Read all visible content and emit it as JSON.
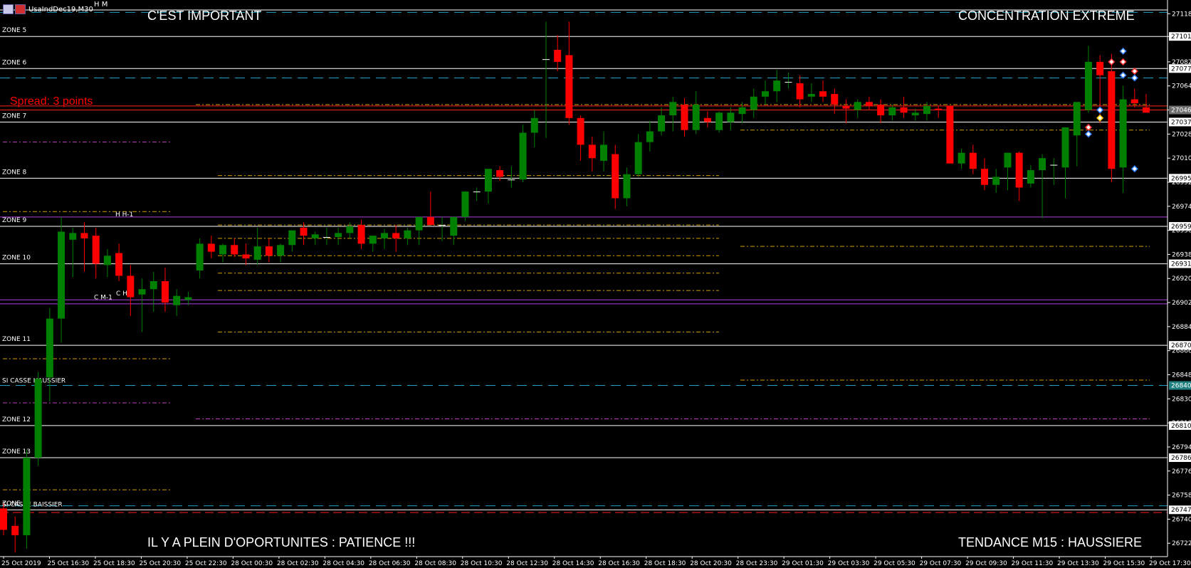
{
  "window": {
    "symbol": "UsaIndDec19,M30",
    "hm_label": "H M"
  },
  "banners": {
    "top_left": "C'EST IMPORTANT",
    "top_right": "CONCENTRATION EXTREME",
    "bottom_left": "IL Y A PLEIN D'OPORTUNITES : PATIENCE !!!",
    "bottom_right": "TENDANCE M15 : HAUSSIERE",
    "spread": "Spread: 3 points"
  },
  "colors": {
    "background": "#000000",
    "bull": "#008000",
    "bear": "#ff0000",
    "zone_line": "#ffffff",
    "cyan_dash": "#20a0c0",
    "orange_dash": "#d4a000",
    "magenta_dash": "#c040c0",
    "red_line": "#ff2020",
    "purple_line": "#b040e0"
  },
  "chart_data": {
    "type": "candlestick",
    "symbol": "UsaIndDec19",
    "timeframe": "M30",
    "ylim": [
      26712,
      27124
    ],
    "y_ticks": [
      27118,
      27101,
      27082,
      27064,
      27046,
      27028,
      27010,
      26992,
      26974,
      26956,
      26938,
      26920,
      26902,
      26884,
      26866,
      26848,
      26830,
      26812,
      26794,
      26776,
      26758,
      26740,
      26722
    ],
    "x_ticks": [
      "25 Oct 2019",
      "25 Oct 16:30",
      "25 Oct 18:30",
      "25 Oct 20:30",
      "25 Oct 22:30",
      "28 Oct 00:30",
      "28 Oct 02:30",
      "28 Oct 04:30",
      "28 Oct 06:30",
      "28 Oct 08:30",
      "28 Oct 10:30",
      "28 Oct 12:30",
      "28 Oct 14:30",
      "28 Oct 16:30",
      "28 Oct 18:30",
      "28 Oct 20:30",
      "28 Oct 23:30",
      "29 Oct 01:30",
      "29 Oct 03:30",
      "29 Oct 05:30",
      "29 Oct 07:30",
      "29 Oct 09:30",
      "29 Oct 11:30",
      "29 Oct 13:30",
      "29 Oct 15:30",
      "29 Oct 17:30"
    ],
    "price_labels": [
      {
        "value": 27101,
        "text": "27101",
        "style": "white"
      },
      {
        "value": 27077,
        "text": "27077",
        "style": "white"
      },
      {
        "value": 27046,
        "text": "27046",
        "style": "grey"
      },
      {
        "value": 27037,
        "text": "27037",
        "style": "white"
      },
      {
        "value": 26995,
        "text": "26995",
        "style": "white"
      },
      {
        "value": 26959,
        "text": "26959",
        "style": "white"
      },
      {
        "value": 26931,
        "text": "26931",
        "style": "white"
      },
      {
        "value": 26870,
        "text": "26870",
        "style": "white"
      },
      {
        "value": 26840,
        "text": "26840",
        "style": "cyan"
      },
      {
        "value": 26810,
        "text": "26810",
        "style": "white"
      },
      {
        "value": 26786,
        "text": "26786",
        "style": "white"
      },
      {
        "value": 26747,
        "text": "26747",
        "style": "white"
      }
    ],
    "zones": [
      {
        "label": "ZONE 5",
        "value": 27101
      },
      {
        "label": "ZONE 6",
        "value": 27077
      },
      {
        "label": "ZONE 7",
        "value": 27037
      },
      {
        "label": "ZONE 8",
        "value": 26995
      },
      {
        "label": "ZONE 9",
        "value": 26959
      },
      {
        "label": "ZONE 10",
        "value": 26931
      },
      {
        "label": "ZONE 11",
        "value": 26870
      },
      {
        "label": "ZONE 12",
        "value": 26810
      },
      {
        "label": "ZONE 13",
        "value": 26786
      },
      {
        "label": "ZONE 14",
        "value": 26747
      }
    ],
    "markers": [
      {
        "label": "SI CASSE HAUSSIER",
        "value": 26840
      },
      {
        "label": "SI CASSE BAISSIER",
        "value": 26748
      },
      {
        "label": "H H-1",
        "value": 26967
      },
      {
        "label": "C M-1",
        "value": 26905
      },
      {
        "label": "C H-1",
        "value": 26908
      }
    ],
    "candles": [
      {
        "o": 26748,
        "h": 26752,
        "l": 26728,
        "c": 26732
      },
      {
        "o": 26735,
        "h": 26742,
        "l": 26715,
        "c": 26728
      },
      {
        "o": 26728,
        "h": 26792,
        "l": 26718,
        "c": 26786
      },
      {
        "o": 26786,
        "h": 26850,
        "l": 26780,
        "c": 26845
      },
      {
        "o": 26846,
        "h": 26898,
        "l": 26828,
        "c": 26890
      },
      {
        "o": 26890,
        "h": 26966,
        "l": 26872,
        "c": 26955
      },
      {
        "o": 26949,
        "h": 26958,
        "l": 26921,
        "c": 26954
      },
      {
        "o": 26954,
        "h": 26962,
        "l": 26925,
        "c": 26950
      },
      {
        "o": 26952,
        "h": 26958,
        "l": 26920,
        "c": 26931
      },
      {
        "o": 26930,
        "h": 26942,
        "l": 26921,
        "c": 26937
      },
      {
        "o": 26939,
        "h": 26946,
        "l": 26918,
        "c": 26922
      },
      {
        "o": 26922,
        "h": 26930,
        "l": 26892,
        "c": 26906
      },
      {
        "o": 26908,
        "h": 26920,
        "l": 26880,
        "c": 26912
      },
      {
        "o": 26912,
        "h": 26925,
        "l": 26895,
        "c": 26918
      },
      {
        "o": 26918,
        "h": 26928,
        "l": 26895,
        "c": 26902
      },
      {
        "o": 26900,
        "h": 26912,
        "l": 26892,
        "c": 26907
      },
      {
        "o": 26904,
        "h": 26910,
        "l": 26900,
        "c": 26906
      },
      {
        "o": 26926,
        "h": 26950,
        "l": 26920,
        "c": 26946
      },
      {
        "o": 26946,
        "h": 26952,
        "l": 26935,
        "c": 26940
      },
      {
        "o": 26938,
        "h": 26946,
        "l": 26932,
        "c": 26945
      },
      {
        "o": 26945,
        "h": 26950,
        "l": 26936,
        "c": 26938
      },
      {
        "o": 26938,
        "h": 26946,
        "l": 26930,
        "c": 26935
      },
      {
        "o": 26934,
        "h": 26958,
        "l": 26930,
        "c": 26944
      },
      {
        "o": 26944,
        "h": 26950,
        "l": 26932,
        "c": 26937
      },
      {
        "o": 26937,
        "h": 26946,
        "l": 26932,
        "c": 26945
      },
      {
        "o": 26945,
        "h": 26952,
        "l": 26940,
        "c": 26956
      },
      {
        "o": 26958,
        "h": 26962,
        "l": 26945,
        "c": 26952
      },
      {
        "o": 26950,
        "h": 26955,
        "l": 26945,
        "c": 26953
      },
      {
        "o": 26951,
        "h": 26958,
        "l": 26945,
        "c": 26951
      },
      {
        "o": 26951,
        "h": 26958,
        "l": 26945,
        "c": 26954
      },
      {
        "o": 26954,
        "h": 26962,
        "l": 26950,
        "c": 26959
      },
      {
        "o": 26960,
        "h": 26964,
        "l": 26942,
        "c": 26946
      },
      {
        "o": 26946,
        "h": 26952,
        "l": 26940,
        "c": 26952
      },
      {
        "o": 26950,
        "h": 26957,
        "l": 26942,
        "c": 26954
      },
      {
        "o": 26954,
        "h": 26960,
        "l": 26940,
        "c": 26950
      },
      {
        "o": 26950,
        "h": 26958,
        "l": 26945,
        "c": 26956
      },
      {
        "o": 26956,
        "h": 26966,
        "l": 26945,
        "c": 26966
      },
      {
        "o": 26966,
        "h": 26985,
        "l": 26960,
        "c": 26960
      },
      {
        "o": 26960,
        "h": 26966,
        "l": 26948,
        "c": 26960
      },
      {
        "o": 26952,
        "h": 26966,
        "l": 26945,
        "c": 26966
      },
      {
        "o": 26966,
        "h": 26985,
        "l": 26963,
        "c": 26985
      },
      {
        "o": 26985,
        "h": 26988,
        "l": 26978,
        "c": 26985
      },
      {
        "o": 26985,
        "h": 27002,
        "l": 26976,
        "c": 27002
      },
      {
        "o": 27001,
        "h": 27004,
        "l": 26993,
        "c": 26996
      },
      {
        "o": 26994,
        "h": 27004,
        "l": 26988,
        "c": 26994
      },
      {
        "o": 26994,
        "h": 27035,
        "l": 26992,
        "c": 27029
      },
      {
        "o": 27029,
        "h": 27046,
        "l": 27018,
        "c": 27040
      },
      {
        "o": 27084,
        "h": 27112,
        "l": 27025,
        "c": 27084
      },
      {
        "o": 27091,
        "h": 27102,
        "l": 27075,
        "c": 27082
      },
      {
        "o": 27087,
        "h": 27112,
        "l": 27035,
        "c": 27040
      },
      {
        "o": 27040,
        "h": 27042,
        "l": 27008,
        "c": 27020
      },
      {
        "o": 27020,
        "h": 27026,
        "l": 27000,
        "c": 27010
      },
      {
        "o": 27008,
        "h": 27030,
        "l": 27000,
        "c": 27020
      },
      {
        "o": 27013,
        "h": 27020,
        "l": 26972,
        "c": 26980
      },
      {
        "o": 26980,
        "h": 27003,
        "l": 26974,
        "c": 26998
      },
      {
        "o": 26998,
        "h": 27028,
        "l": 26996,
        "c": 27022
      },
      {
        "o": 27022,
        "h": 27038,
        "l": 27015,
        "c": 27030
      },
      {
        "o": 27030,
        "h": 27048,
        "l": 27027,
        "c": 27042
      },
      {
        "o": 27042,
        "h": 27056,
        "l": 27030,
        "c": 27052
      },
      {
        "o": 27050,
        "h": 27055,
        "l": 27026,
        "c": 27031
      },
      {
        "o": 27031,
        "h": 27060,
        "l": 27028,
        "c": 27050
      },
      {
        "o": 27040,
        "h": 27045,
        "l": 27033,
        "c": 27037
      },
      {
        "o": 27031,
        "h": 27045,
        "l": 27029,
        "c": 27044
      },
      {
        "o": 27037,
        "h": 27048,
        "l": 27031,
        "c": 27044
      },
      {
        "o": 27043,
        "h": 27052,
        "l": 27036,
        "c": 27048
      },
      {
        "o": 27046,
        "h": 27062,
        "l": 27040,
        "c": 27056
      },
      {
        "o": 27056,
        "h": 27068,
        "l": 27050,
        "c": 27060
      },
      {
        "o": 27060,
        "h": 27076,
        "l": 27052,
        "c": 27068
      },
      {
        "o": 27067,
        "h": 27074,
        "l": 27062,
        "c": 27067
      },
      {
        "o": 27066,
        "h": 27072,
        "l": 27048,
        "c": 27054
      },
      {
        "o": 27056,
        "h": 27066,
        "l": 27052,
        "c": 27058
      },
      {
        "o": 27060,
        "h": 27068,
        "l": 27052,
        "c": 27056
      },
      {
        "o": 27058,
        "h": 27062,
        "l": 27043,
        "c": 27050
      },
      {
        "o": 27049,
        "h": 27054,
        "l": 27036,
        "c": 27047
      },
      {
        "o": 27046,
        "h": 27054,
        "l": 27040,
        "c": 27052
      },
      {
        "o": 27052,
        "h": 27056,
        "l": 27046,
        "c": 27049
      },
      {
        "o": 27050,
        "h": 27054,
        "l": 27036,
        "c": 27042
      },
      {
        "o": 27042,
        "h": 27050,
        "l": 27038,
        "c": 27048
      },
      {
        "o": 27048,
        "h": 27056,
        "l": 27040,
        "c": 27044
      },
      {
        "o": 27042,
        "h": 27047,
        "l": 27038,
        "c": 27044
      },
      {
        "o": 27043,
        "h": 27052,
        "l": 27038,
        "c": 27049
      },
      {
        "o": 27047,
        "h": 27049,
        "l": 27040,
        "c": 27046
      },
      {
        "o": 27049,
        "h": 27049,
        "l": 27006,
        "c": 27006
      },
      {
        "o": 27006,
        "h": 27017,
        "l": 27002,
        "c": 27014
      },
      {
        "o": 27014,
        "h": 27020,
        "l": 26998,
        "c": 27002
      },
      {
        "o": 27002,
        "h": 27010,
        "l": 26986,
        "c": 26990
      },
      {
        "o": 26990,
        "h": 27002,
        "l": 26984,
        "c": 26996
      },
      {
        "o": 27003,
        "h": 27014,
        "l": 26986,
        "c": 27014
      },
      {
        "o": 27014,
        "h": 27015,
        "l": 26978,
        "c": 26988
      },
      {
        "o": 26991,
        "h": 27005,
        "l": 26988,
        "c": 27001
      },
      {
        "o": 27001,
        "h": 27013,
        "l": 26965,
        "c": 27010
      },
      {
        "o": 27005,
        "h": 27010,
        "l": 26990,
        "c": 27005
      },
      {
        "o": 27003,
        "h": 27028,
        "l": 26980,
        "c": 27033
      },
      {
        "o": 27027,
        "h": 27037,
        "l": 27004,
        "c": 27052
      },
      {
        "o": 27046,
        "h": 27094,
        "l": 27044,
        "c": 27082
      },
      {
        "o": 27082,
        "h": 27087,
        "l": 27036,
        "c": 27072
      },
      {
        "o": 27075,
        "h": 27088,
        "l": 26992,
        "c": 27002
      },
      {
        "o": 27003,
        "h": 27064,
        "l": 26984,
        "c": 27054
      },
      {
        "o": 27054,
        "h": 27062,
        "l": 27048,
        "c": 27051
      },
      {
        "o": 27048,
        "h": 27058,
        "l": 27044,
        "c": 27044
      }
    ]
  }
}
